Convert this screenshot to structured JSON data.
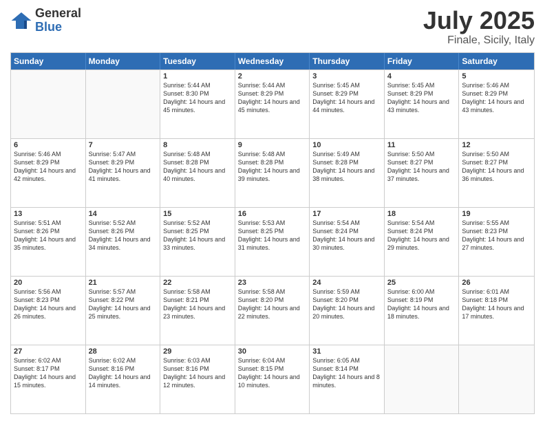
{
  "logo": {
    "general": "General",
    "blue": "Blue"
  },
  "title": {
    "month": "July 2025",
    "location": "Finale, Sicily, Italy"
  },
  "calendar": {
    "headers": [
      "Sunday",
      "Monday",
      "Tuesday",
      "Wednesday",
      "Thursday",
      "Friday",
      "Saturday"
    ],
    "rows": [
      [
        {
          "day": "",
          "info": ""
        },
        {
          "day": "",
          "info": ""
        },
        {
          "day": "1",
          "info": "Sunrise: 5:44 AM\nSunset: 8:30 PM\nDaylight: 14 hours and 45 minutes."
        },
        {
          "day": "2",
          "info": "Sunrise: 5:44 AM\nSunset: 8:29 PM\nDaylight: 14 hours and 45 minutes."
        },
        {
          "day": "3",
          "info": "Sunrise: 5:45 AM\nSunset: 8:29 PM\nDaylight: 14 hours and 44 minutes."
        },
        {
          "day": "4",
          "info": "Sunrise: 5:45 AM\nSunset: 8:29 PM\nDaylight: 14 hours and 43 minutes."
        },
        {
          "day": "5",
          "info": "Sunrise: 5:46 AM\nSunset: 8:29 PM\nDaylight: 14 hours and 43 minutes."
        }
      ],
      [
        {
          "day": "6",
          "info": "Sunrise: 5:46 AM\nSunset: 8:29 PM\nDaylight: 14 hours and 42 minutes."
        },
        {
          "day": "7",
          "info": "Sunrise: 5:47 AM\nSunset: 8:29 PM\nDaylight: 14 hours and 41 minutes."
        },
        {
          "day": "8",
          "info": "Sunrise: 5:48 AM\nSunset: 8:28 PM\nDaylight: 14 hours and 40 minutes."
        },
        {
          "day": "9",
          "info": "Sunrise: 5:48 AM\nSunset: 8:28 PM\nDaylight: 14 hours and 39 minutes."
        },
        {
          "day": "10",
          "info": "Sunrise: 5:49 AM\nSunset: 8:28 PM\nDaylight: 14 hours and 38 minutes."
        },
        {
          "day": "11",
          "info": "Sunrise: 5:50 AM\nSunset: 8:27 PM\nDaylight: 14 hours and 37 minutes."
        },
        {
          "day": "12",
          "info": "Sunrise: 5:50 AM\nSunset: 8:27 PM\nDaylight: 14 hours and 36 minutes."
        }
      ],
      [
        {
          "day": "13",
          "info": "Sunrise: 5:51 AM\nSunset: 8:26 PM\nDaylight: 14 hours and 35 minutes."
        },
        {
          "day": "14",
          "info": "Sunrise: 5:52 AM\nSunset: 8:26 PM\nDaylight: 14 hours and 34 minutes."
        },
        {
          "day": "15",
          "info": "Sunrise: 5:52 AM\nSunset: 8:25 PM\nDaylight: 14 hours and 33 minutes."
        },
        {
          "day": "16",
          "info": "Sunrise: 5:53 AM\nSunset: 8:25 PM\nDaylight: 14 hours and 31 minutes."
        },
        {
          "day": "17",
          "info": "Sunrise: 5:54 AM\nSunset: 8:24 PM\nDaylight: 14 hours and 30 minutes."
        },
        {
          "day": "18",
          "info": "Sunrise: 5:54 AM\nSunset: 8:24 PM\nDaylight: 14 hours and 29 minutes."
        },
        {
          "day": "19",
          "info": "Sunrise: 5:55 AM\nSunset: 8:23 PM\nDaylight: 14 hours and 27 minutes."
        }
      ],
      [
        {
          "day": "20",
          "info": "Sunrise: 5:56 AM\nSunset: 8:23 PM\nDaylight: 14 hours and 26 minutes."
        },
        {
          "day": "21",
          "info": "Sunrise: 5:57 AM\nSunset: 8:22 PM\nDaylight: 14 hours and 25 minutes."
        },
        {
          "day": "22",
          "info": "Sunrise: 5:58 AM\nSunset: 8:21 PM\nDaylight: 14 hours and 23 minutes."
        },
        {
          "day": "23",
          "info": "Sunrise: 5:58 AM\nSunset: 8:20 PM\nDaylight: 14 hours and 22 minutes."
        },
        {
          "day": "24",
          "info": "Sunrise: 5:59 AM\nSunset: 8:20 PM\nDaylight: 14 hours and 20 minutes."
        },
        {
          "day": "25",
          "info": "Sunrise: 6:00 AM\nSunset: 8:19 PM\nDaylight: 14 hours and 18 minutes."
        },
        {
          "day": "26",
          "info": "Sunrise: 6:01 AM\nSunset: 8:18 PM\nDaylight: 14 hours and 17 minutes."
        }
      ],
      [
        {
          "day": "27",
          "info": "Sunrise: 6:02 AM\nSunset: 8:17 PM\nDaylight: 14 hours and 15 minutes."
        },
        {
          "day": "28",
          "info": "Sunrise: 6:02 AM\nSunset: 8:16 PM\nDaylight: 14 hours and 14 minutes."
        },
        {
          "day": "29",
          "info": "Sunrise: 6:03 AM\nSunset: 8:16 PM\nDaylight: 14 hours and 12 minutes."
        },
        {
          "day": "30",
          "info": "Sunrise: 6:04 AM\nSunset: 8:15 PM\nDaylight: 14 hours and 10 minutes."
        },
        {
          "day": "31",
          "info": "Sunrise: 6:05 AM\nSunset: 8:14 PM\nDaylight: 14 hours and 8 minutes."
        },
        {
          "day": "",
          "info": ""
        },
        {
          "day": "",
          "info": ""
        }
      ]
    ]
  }
}
